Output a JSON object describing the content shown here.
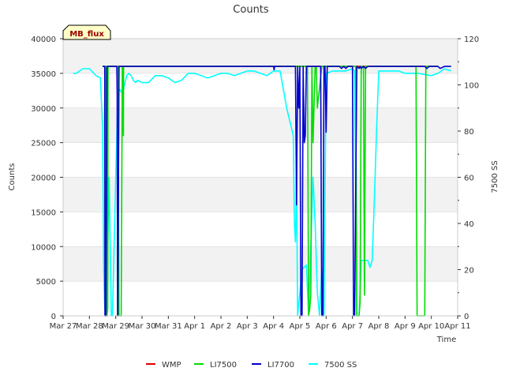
{
  "chart_data": {
    "type": "line",
    "title": "Counts",
    "badge": "MB_flux",
    "xlabel": "Time",
    "ylabel_left": "Counts",
    "ylabel_right": "7500 SS",
    "ylim_left": [
      0,
      40000
    ],
    "ylim_right": [
      0,
      120
    ],
    "x_range": [
      "Mar 27",
      "Apr 11"
    ],
    "x_ticks": [
      "Mar 27",
      "Mar 28",
      "Mar 29",
      "Mar 30",
      "Mar 31",
      "Apr 1",
      "Apr 2",
      "Apr 3",
      "Apr 4",
      "Apr 5",
      "Apr 6",
      "Apr 7",
      "Apr 8",
      "Apr 9",
      "Apr 10",
      "Apr 11"
    ],
    "y_ticks_left": [
      0,
      5000,
      10000,
      15000,
      20000,
      25000,
      30000,
      35000,
      40000
    ],
    "y_ticks_right": [
      0,
      20,
      40,
      60,
      80,
      100,
      120
    ],
    "grid": true,
    "banded_background": true,
    "legend_position": "bottom",
    "colors": {
      "WMP": "#dd0000",
      "LI7500": "#00dd00",
      "LI7700": "#0000cc",
      "7500 SS": "#00ffff"
    },
    "series": [
      {
        "name": "WMP",
        "axis": "left",
        "x": [
          "Mar 28 12:00",
          "Mar 28 14:00",
          "Mar 28 14:30",
          "Mar 28 16:00",
          "Mar 28 16:30",
          "Apr 10 06:00"
        ],
        "values": [
          36000,
          36000,
          0,
          0,
          36000,
          36000
        ]
      },
      {
        "name": "LI7500",
        "axis": "left",
        "x": [
          "Mar 28 12:00",
          "Mar 28 15:00",
          "Mar 28 15:20",
          "Mar 28 15:40",
          "Mar 28 16:00",
          "Mar 28 16:40",
          "Mar 28 17:00",
          "Mar 29 00:00",
          "Mar 29 02:00",
          "Mar 29 03:00",
          "Mar 29 05:00",
          "Mar 29 06:00",
          "Mar 29 07:00",
          "Mar 29 07:10",
          "Mar 29 08:00",
          "Mar 29 08:30",
          "Mar 29 09:00",
          "Apr 5 00:00",
          "Apr 5 06:00",
          "Apr 5 07:00",
          "Apr 5 08:00",
          "Apr 5 09:00",
          "Apr 5 10:00",
          "Apr 5 11:00",
          "Apr 5 12:00",
          "Apr 5 14:00",
          "Apr 5 15:00",
          "Apr 5 16:00",
          "Apr 5 20:00",
          "Apr 5 21:00",
          "Apr 5 23:00",
          "Apr 6 00:00",
          "Apr 6 01:00",
          "Apr 7 00:00",
          "Apr 7 03:00",
          "Apr 7 04:00",
          "Apr 7 06:00",
          "Apr 7 07:00",
          "Apr 7 08:00",
          "Apr 7 09:00",
          "Apr 7 10:00",
          "Apr 7 11:00",
          "Apr 7 12:00",
          "Apr 7 13:00",
          "Apr 7 14:00",
          "Apr 9 00:00",
          "Apr 9 10:00",
          "Apr 9 11:00",
          "Apr 9 18:00",
          "Apr 9 19:00",
          "Apr 10 06:00"
        ],
        "values": [
          36000,
          36000,
          12000,
          32000,
          0,
          1000,
          36000,
          36000,
          36000,
          0,
          0,
          36000,
          26000,
          36000,
          36000,
          36000,
          36000,
          36000,
          36000,
          36000,
          0,
          1000,
          3000,
          36000,
          25000,
          36000,
          36000,
          30000,
          36000,
          36000,
          36000,
          36000,
          36000,
          36000,
          36000,
          0,
          0,
          2000,
          36000,
          36000,
          36000,
          3000,
          36000,
          36000,
          36000,
          36000,
          36000,
          0,
          0,
          36000,
          36000
        ]
      },
      {
        "name": "LI7700",
        "axis": "left",
        "x": [
          "Mar 28 12:00",
          "Mar 28 14:00",
          "Mar 28 14:10",
          "Mar 28 15:00",
          "Mar 28 16:00",
          "Mar 28 17:00",
          "Mar 29 00:00",
          "Mar 29 01:00",
          "Mar 29 01:20",
          "Mar 29 01:40",
          "Mar 29 02:00",
          "Mar 29 03:00",
          "Mar 29 04:00",
          "Mar 29 05:00",
          "Mar 29 06:00",
          "Apr 4 00:00",
          "Apr 4 00:30",
          "Apr 4 01:00",
          "Apr 4 20:00",
          "Apr 4 21:00",
          "Apr 4 22:00",
          "Apr 4 23:00",
          "Apr 5 00:00",
          "Apr 5 01:00",
          "Apr 5 02:00",
          "Apr 5 03:00",
          "Apr 5 04:00",
          "Apr 5 05:00",
          "Apr 5 06:00",
          "Apr 5 18:00",
          "Apr 5 19:00",
          "Apr 5 20:00",
          "Apr 5 21:00",
          "Apr 5 22:00",
          "Apr 5 23:00",
          "Apr 6 00:00",
          "Apr 6 01:00",
          "Apr 6 02:00",
          "Apr 6 12:00",
          "Apr 6 14:00",
          "Apr 6 16:00",
          "Apr 6 18:00",
          "Apr 6 20:00",
          "Apr 6 22:00",
          "Apr 7 00:00",
          "Apr 7 01:00",
          "Apr 7 02:00",
          "Apr 7 04:00",
          "Apr 7 06:00",
          "Apr 7 07:00",
          "Apr 7 08:00",
          "Apr 7 10:00",
          "Apr 7 12:00",
          "Apr 7 14:00",
          "Apr 7 16:00",
          "Apr 8 00:00",
          "Apr 9 18:00",
          "Apr 9 20:00",
          "Apr 9 22:00",
          "Apr 10 06:00",
          "Apr 10 08:00",
          "Apr 10 12:00",
          "Apr 10 18:00"
        ],
        "values": [
          36000,
          36000,
          0,
          0,
          36000,
          36000,
          36000,
          36000,
          32000,
          0,
          0,
          36000,
          36000,
          36000,
          36000,
          36000,
          35500,
          36000,
          36000,
          16000,
          36000,
          30000,
          36000,
          0,
          0,
          36000,
          25000,
          26000,
          36000,
          36000,
          36000,
          0,
          0,
          36000,
          36000,
          26500,
          36000,
          36000,
          36000,
          35700,
          36000,
          35700,
          36000,
          36000,
          36000,
          0,
          0,
          36000,
          35700,
          36000,
          35700,
          36000,
          35700,
          36000,
          36000,
          36000,
          36000,
          35700,
          36000,
          36000,
          35700,
          36000,
          36000
        ]
      },
      {
        "name": "7500 SS",
        "axis": "right",
        "x": [
          "Mar 27 09:00",
          "Mar 27 12:00",
          "Mar 27 18:00",
          "Mar 28 00:00",
          "Mar 28 06:00",
          "Mar 28 10:00",
          "Mar 28 12:00",
          "Mar 28 13:00",
          "Mar 28 14:00",
          "Mar 28 15:00",
          "Mar 28 16:00",
          "Mar 28 17:00",
          "Mar 28 18:00",
          "Mar 28 20:00",
          "Mar 28 21:00",
          "Mar 28 22:00",
          "Mar 29 00:00",
          "Mar 29 02:00",
          "Mar 29 04:00",
          "Mar 29 06:00",
          "Mar 29 08:00",
          "Mar 29 10:00",
          "Mar 29 12:00",
          "Mar 29 14:00",
          "Mar 29 16:00",
          "Mar 29 18:00",
          "Mar 29 20:00",
          "Mar 30 00:00",
          "Mar 30 06:00",
          "Mar 30 12:00",
          "Mar 30 18:00",
          "Mar 31 00:00",
          "Mar 31 06:00",
          "Mar 31 12:00",
          "Mar 31 18:00",
          "Apr 1 00:00",
          "Apr 1 06:00",
          "Apr 1 12:00",
          "Apr 1 18:00",
          "Apr 2 00:00",
          "Apr 2 06:00",
          "Apr 2 12:00",
          "Apr 2 18:00",
          "Apr 3 00:00",
          "Apr 3 06:00",
          "Apr 3 12:00",
          "Apr 3 18:00",
          "Apr 4 00:00",
          "Apr 4 06:00",
          "Apr 4 12:00",
          "Apr 4 18:00",
          "Apr 4 19:00",
          "Apr 4 20:00",
          "Apr 4 21:00",
          "Apr 4 22:00",
          "Apr 4 23:00",
          "Apr 5 00:00",
          "Apr 5 02:00",
          "Apr 5 06:00",
          "Apr 5 08:00",
          "Apr 5 10:00",
          "Apr 5 12:00",
          "Apr 5 14:00",
          "Apr 5 16:00",
          "Apr 5 18:00",
          "Apr 5 20:00",
          "Apr 5 21:00",
          "Apr 5 22:00",
          "Apr 6 00:00",
          "Apr 6 06:00",
          "Apr 6 12:00",
          "Apr 6 18:00",
          "Apr 7 00:00",
          "Apr 7 02:00",
          "Apr 7 04:00",
          "Apr 7 06:00",
          "Apr 7 08:00",
          "Apr 7 10:00",
          "Apr 7 12:00",
          "Apr 7 14:00",
          "Apr 7 16:00",
          "Apr 7 18:00",
          "Apr 7 20:00",
          "Apr 7 22:00",
          "Apr 8 00:00",
          "Apr 8 06:00",
          "Apr 8 12:00",
          "Apr 8 18:00",
          "Apr 9 00:00",
          "Apr 9 12:00",
          "Apr 10 00:00",
          "Apr 10 06:00",
          "Apr 10 12:00",
          "Apr 10 18:00"
        ],
        "values": [
          105,
          105,
          107,
          107,
          104,
          103,
          82,
          20,
          3,
          2,
          1,
          35,
          60,
          0,
          0,
          20,
          60,
          97,
          98,
          96,
          100,
          104,
          105,
          104,
          102,
          101,
          102,
          101,
          101,
          104,
          104,
          103,
          101,
          102,
          105,
          105,
          104,
          103,
          104,
          105,
          105,
          104,
          105,
          106,
          106,
          105,
          104,
          106,
          106,
          90,
          78,
          40,
          32,
          60,
          0,
          5,
          10,
          20,
          22,
          0,
          30,
          60,
          40,
          10,
          0,
          20,
          0,
          0,
          105,
          106,
          106,
          106,
          107,
          106,
          0,
          0,
          24,
          24,
          24,
          24,
          21,
          24,
          50,
          80,
          106,
          106,
          106,
          106,
          105,
          105,
          104,
          105,
          107,
          106
        ]
      }
    ]
  }
}
